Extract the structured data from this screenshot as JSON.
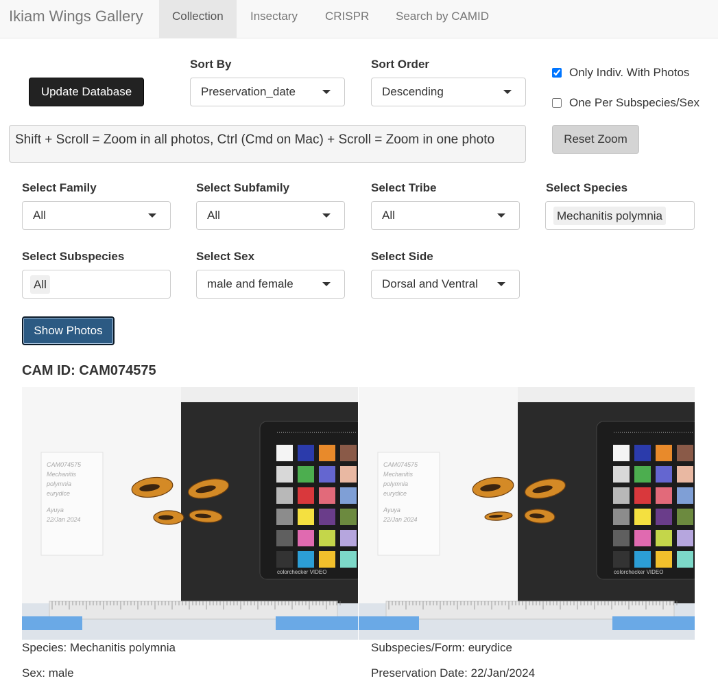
{
  "app": {
    "brand": "Ikiam Wings Gallery"
  },
  "nav": {
    "tabs": [
      {
        "label": "Collection",
        "active": true
      },
      {
        "label": "Insectary",
        "active": false
      },
      {
        "label": "CRISPR",
        "active": false
      },
      {
        "label": "Search by CAMID",
        "active": false
      }
    ]
  },
  "controls": {
    "update_button": "Update Database",
    "sort_by": {
      "label": "Sort By",
      "value": "Preservation_date"
    },
    "sort_order": {
      "label": "Sort Order",
      "value": "Descending"
    },
    "only_with_photos": {
      "label": "Only Indiv. With Photos",
      "checked": true
    },
    "one_per_subspecies": {
      "label": "One Per Subspecies/Sex",
      "checked": false
    },
    "zoom_hint": "Shift + Scroll = Zoom in all photos, Ctrl (Cmd on Mac) + Scroll = Zoom in one photo",
    "reset_zoom": "Reset Zoom"
  },
  "filters": {
    "family": {
      "label": "Select Family",
      "value": "All"
    },
    "subfamily": {
      "label": "Select Subfamily",
      "value": "All"
    },
    "tribe": {
      "label": "Select Tribe",
      "value": "All"
    },
    "species": {
      "label": "Select Species",
      "value": "Mechanitis polymnia"
    },
    "subspecies": {
      "label": "Select Subspecies",
      "value": "All"
    },
    "sex": {
      "label": "Select Sex",
      "value": "male and female"
    },
    "side": {
      "label": "Select Side",
      "value": "Dorsal and Ventral"
    }
  },
  "show_photos_button": "Show Photos",
  "record": {
    "cam_id": "CAM ID: CAM074575",
    "species": "Species: Mechanitis polymnia",
    "subspecies": "Subspecies/Form: eurydice",
    "sex": "Sex: male",
    "preservation_date": "Preservation Date: 22/Jan/2024"
  },
  "photo_label": {
    "lines": [
      "CAM074575",
      "Mechanitis",
      "polymnia",
      "eurydice",
      "Ayuya",
      "22/Jan 2024"
    ],
    "checker_text": "colorchecker VIDEO"
  },
  "colors": {
    "navbar_bg": "#f8f8f8",
    "primary": "#2c5a83",
    "dark_button": "#222222",
    "checker_patches": [
      "#f4f4f4",
      "#2b3bab",
      "#e88a2b",
      "#8a5a48",
      "#d8d8d8",
      "#4cae4f",
      "#6466d0",
      "#e9b8a2",
      "#b8b8b8",
      "#d9383c",
      "#e26a7a",
      "#7f9fd6",
      "#8c8c8c",
      "#f4e040",
      "#6a3d8a",
      "#6c8a3f",
      "#5f5f5f",
      "#e06ab0",
      "#c4d64a",
      "#b6a6de",
      "#333333",
      "#2c9ed6",
      "#f2c02c",
      "#7cd8c8"
    ]
  }
}
